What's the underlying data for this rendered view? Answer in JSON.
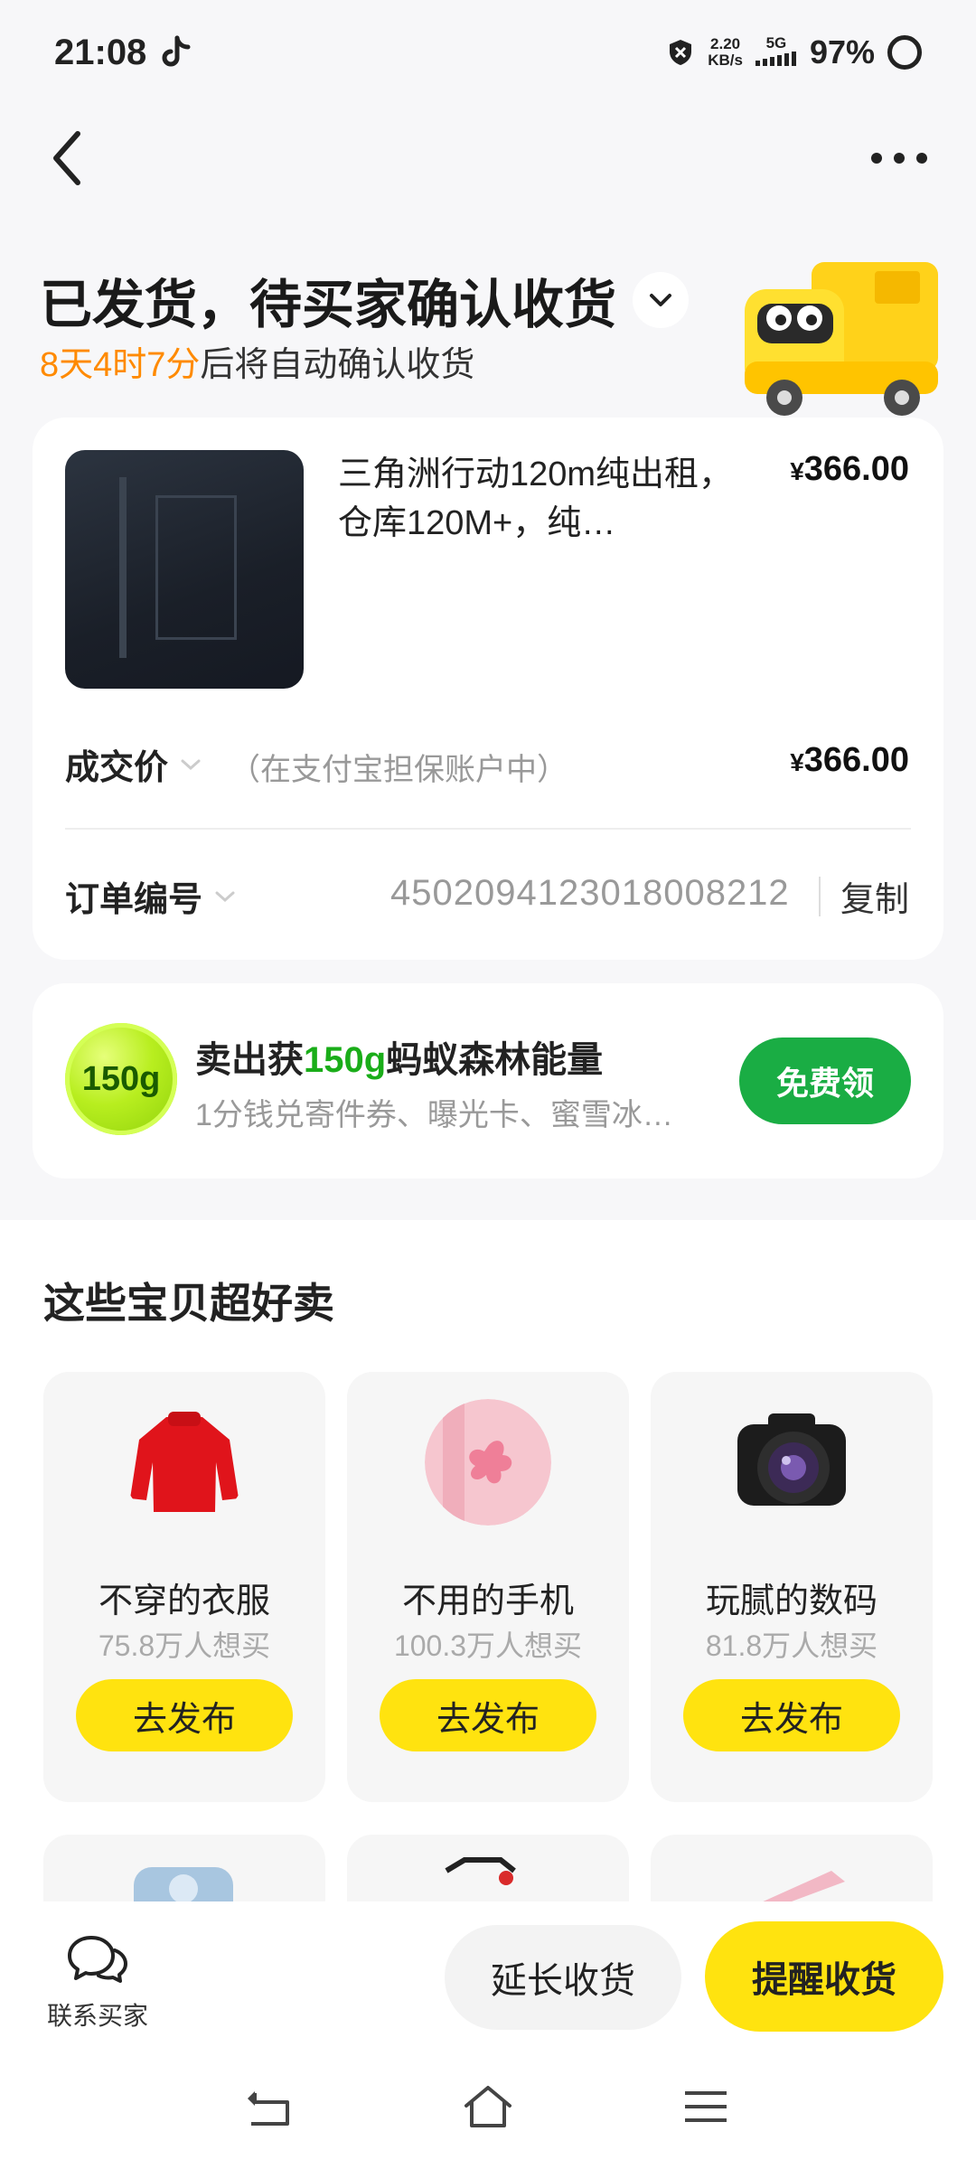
{
  "status_bar": {
    "time": "21:08",
    "net_speed_value": "2.20",
    "net_speed_unit": "KB/s",
    "network": "5G",
    "battery": "97%"
  },
  "header": {
    "title": "已发货，待买家确认收货",
    "countdown": "8天4时7分",
    "countdown_suffix": "后将自动确认收货"
  },
  "order": {
    "item_title": "三角洲行动120m纯出租，仓库120M+，纯…",
    "item_price_symbol": "¥",
    "item_price": "366.00",
    "deal_label": "成交价",
    "deal_note": "（在支付宝担保账户中）",
    "deal_price_symbol": "¥",
    "deal_price": "366.00",
    "order_no_label": "订单编号",
    "order_no": "4502094123018008212",
    "copy_label": "复制"
  },
  "energy": {
    "badge": "150g",
    "title_prefix": "卖出获",
    "title_highlight": "150g",
    "title_suffix": "蚂蚁森林能量",
    "subtitle": "1分钱兑寄件券、曝光卡、蜜雪冰…",
    "button": "免费领"
  },
  "recommend": {
    "title": "这些宝贝超好卖",
    "items": [
      {
        "name": "不穿的衣服",
        "count": "75.8万人想买",
        "button": "去发布"
      },
      {
        "name": "不用的手机",
        "count": "100.3万人想买",
        "button": "去发布"
      },
      {
        "name": "玩腻的数码",
        "count": "81.8万人想买",
        "button": "去发布"
      }
    ]
  },
  "bottom": {
    "contact": "联系买家",
    "extend": "延长收货",
    "remind": "提醒收货"
  },
  "colors": {
    "accent_yellow": "#ffe30f",
    "countdown_orange": "#ff8a00",
    "energy_green": "#1aad44"
  }
}
